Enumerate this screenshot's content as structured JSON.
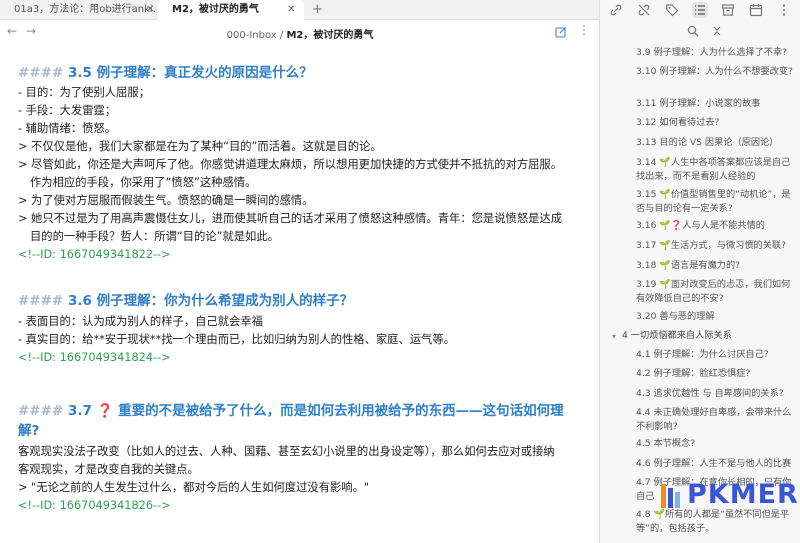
{
  "tabs": [
    {
      "label": "01a3，方法论：用ob进行anki...",
      "active": false
    },
    {
      "label": "M2，被讨厌的勇气",
      "active": true
    }
  ],
  "breadcrumb": {
    "folder": "000-Inbox",
    "separator": "/",
    "note": "M2，被讨厌的勇气"
  },
  "colors": {
    "heading": "#2f7fc9",
    "hash": "#a6b9cd",
    "id_comment": "#2ba24c",
    "question_mark": "#e0281c",
    "logo": "#3a56d4"
  },
  "sections": [
    {
      "hash": "####",
      "title": "3.5 例子理解：真正发火的原因是什么？",
      "lines": [
        "- 目的：为了使别人屈服；",
        "- 手段：大发雷霆；",
        "- 辅助情绪：愤怒。",
        "> 不仅仅是他，我们大家都是在为了某种“目的”而活着。这就是目的论。",
        "> 尽管如此，你还是大声呵斥了他。你感觉讲道理太麻烦，所以想用更加快捷的方式使并不抵抗的对方屈服。",
        "  作为相应的手段，你采用了“愤怒”这种感情。",
        "> 为了使对方屈服而假装生气。愤怒的确是一瞬间的感情。",
        "> 她只不过是为了用高声震慑住女儿，进而使其听自己的话才采用了愤怒这种感情。青年：您是说愤怒是达成",
        "  目的的一种手段？哲人：所谓“目的论”就是如此。"
      ],
      "id": "<!--ID: 1667049341822-->"
    },
    {
      "hash": "####",
      "title": "3.6 例子理解：你为什么希望成为别人的样子？",
      "lines": [
        "- 表面目的：认为成为别人的样子，自己就会幸福",
        "- 真实目的：给**安于现状**找一个理由而已，比如归纳为别人的性格、家庭、运气等。"
      ],
      "id": "<!--ID: 1667049341824-->"
    },
    {
      "hash": "####",
      "number": "3.7",
      "qmark": "❓",
      "title_line1": "重要的不是被给予了什么，而是如何去利用被给予的东西——这句话如何理",
      "title_line2": "解?",
      "lines": [
        "客观现实没法子改变（比如人的过去、人种、国藉、甚至玄幻小说里的出身设定等），那么如何去应对或接纳",
        "客观现实，才是改变自我的关键点。",
        "> \"无论之前的人生发生过什么，都对今后的人生如何度过没有影响。\""
      ],
      "id": "<!--ID: 1667049341826-->"
    }
  ],
  "outline": [
    {
      "level": 2,
      "text": "3.9 例子理解：人为什么选择了不幸?"
    },
    {
      "level": 2,
      "text": "3.10 例子理解：人为什么不想要改变?"
    },
    {
      "level": 2,
      "text": "3.11 例子理解：小说家的故事"
    },
    {
      "level": 2,
      "text": "3.12 如何看待过去?"
    },
    {
      "level": 2,
      "text": "3.13 目的论 VS 因果论（原因论）"
    },
    {
      "level": 2,
      "text": "3.14 🌱人生中各项答案都应该是自己找出来，而不是看别人经验的"
    },
    {
      "level": 2,
      "text": "3.15 🌱价值型销售里的“动机论”，是否与目的论有一定关系?"
    },
    {
      "level": 2,
      "text": "3.16 🌱❓人与人是不能共情的"
    },
    {
      "level": 2,
      "text": "3.17 🌱生活方式，与微习惯的关联?"
    },
    {
      "level": 2,
      "text": "3.18 🌱语言是有魔力的?"
    },
    {
      "level": 2,
      "text": "3.19 🌱面对改变后的忐忑，我们如何有效降低自己的不安?"
    },
    {
      "level": 2,
      "text": "3.20 善与恶的理解"
    },
    {
      "level": 1,
      "text": "4 一切烦恼都来自人际关系"
    },
    {
      "level": 2,
      "text": "4.1 例子理解：为什么讨厌自己?"
    },
    {
      "level": 2,
      "text": "4.2 例子理解：脸红恐惧症?"
    },
    {
      "level": 2,
      "text": "4.3 追求优越性 与 自卑感间的关系?"
    },
    {
      "level": 2,
      "text": "4.4 未正确处理好自卑感，会带来什么不利影响?"
    },
    {
      "level": 2,
      "text": "4.5 本节概念?"
    },
    {
      "level": 2,
      "text": "4.6 例子理解：人生不是与他人的比赛"
    },
    {
      "level": 2,
      "text": "4.7 例子理解：在意你长相的，只有你自己"
    },
    {
      "level": 2,
      "text": "4.8 🌱所有的人都是“虽然不同但是平等”的，包括孩子。"
    }
  ],
  "logo": {
    "text": "PKMER"
  }
}
